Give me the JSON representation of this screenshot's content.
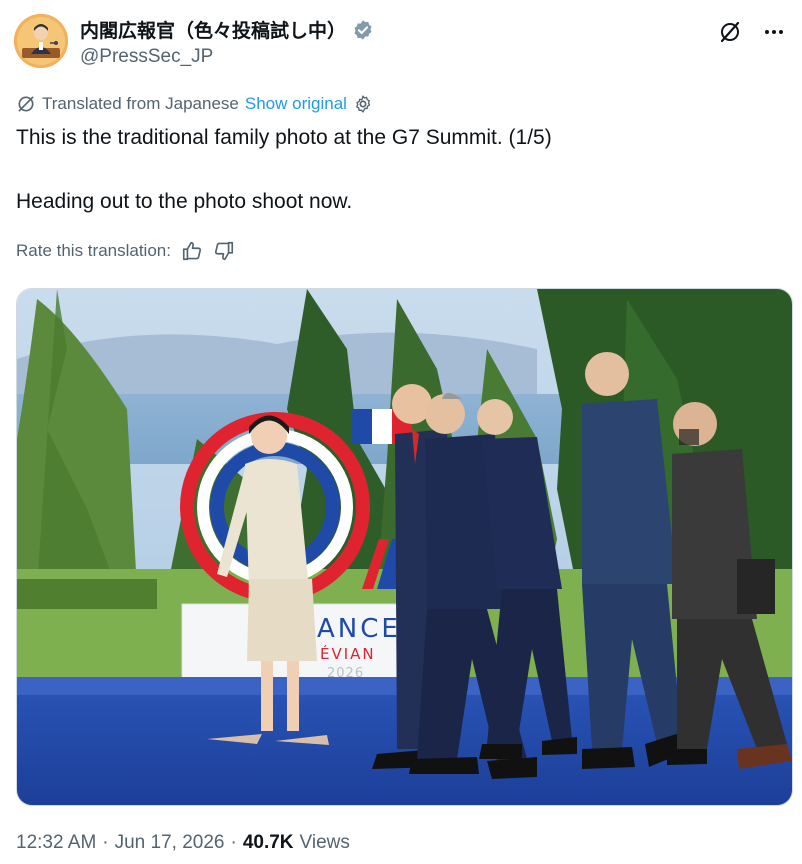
{
  "author": {
    "display_name": "内閣広報官（色々投稿試し中）",
    "handle": "@PressSec_JP",
    "verified": true
  },
  "translation": {
    "notice": "Translated from Japanese",
    "show_original": "Show original"
  },
  "tweet": {
    "lines": [
      "This is the traditional family photo at the G7 Summit. (1/5)",
      "Heading out to the photo shoot now."
    ]
  },
  "rate": {
    "label": "Rate this translation:"
  },
  "media": {
    "sign_text_1": "ANCE",
    "sign_text_2": "ÉVIAN",
    "sign_text_3": "2026",
    "description_colors": {
      "blue": "#1f4aa8",
      "red": "#e0242f",
      "sky": "#aecde8"
    }
  },
  "meta": {
    "time": "12:32 AM",
    "separator": "·",
    "date": "Jun 17, 2026",
    "separator2": "·",
    "views_count": "40.7K",
    "views_label": "Views"
  },
  "colors": {
    "text": "#0f1419",
    "secondary": "#536471",
    "link": "#1d9bf0",
    "verified": "#829aab"
  }
}
